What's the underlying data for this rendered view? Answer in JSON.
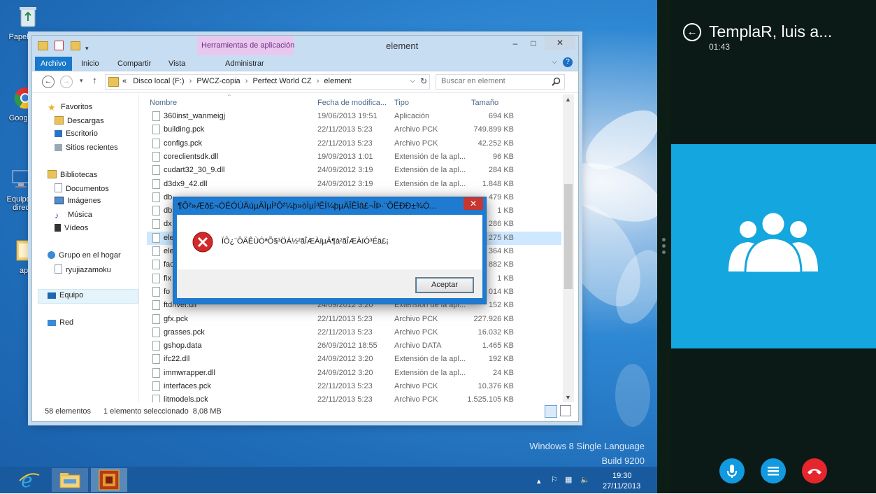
{
  "desktop": {
    "icons": [
      {
        "label": "Papelera de reciclaje",
        "short": "Papele reci"
      },
      {
        "label": "Google Chrome",
        "short": "Google C"
      },
      {
        "label": "Equipo - direct",
        "short": "Equipo - direc"
      },
      {
        "label": "ap",
        "short": "ap"
      }
    ],
    "watermark_line1": "Windows 8 Single Language",
    "watermark_line2": "Build 9200"
  },
  "explorer": {
    "title": "element",
    "contextual_group": "Herramientas de aplicación",
    "tabs": [
      "Archivo",
      "Inicio",
      "Compartir",
      "Vista",
      "Administrar"
    ],
    "breadcrumb": [
      "«",
      "Disco local (F:)",
      "PWCZ-copia",
      "Perfect World CZ",
      "element"
    ],
    "search_placeholder": "Buscar en element",
    "nav": {
      "favorites": "Favoritos",
      "downloads": "Descargas",
      "desktop": "Escritorio",
      "recent": "Sitios recientes",
      "libraries": "Bibliotecas",
      "documents": "Documentos",
      "images": "Imágenes",
      "music": "Música",
      "videos": "Vídeos",
      "homegroup": "Grupo en el hogar",
      "user": "ryujiazamoku",
      "computer": "Equipo",
      "network": "Red"
    },
    "columns": {
      "name": "Nombre",
      "date": "Fecha de modifica...",
      "type": "Tipo",
      "size": "Tamaño"
    },
    "rows": [
      {
        "name": "360inst_wanmeigj",
        "date": "19/06/2013 19:51",
        "type": "Aplicación",
        "size": "694 KB"
      },
      {
        "name": "building.pck",
        "date": "22/11/2013 5:23",
        "type": "Archivo PCK",
        "size": "749.899 KB"
      },
      {
        "name": "configs.pck",
        "date": "22/11/2013 5:23",
        "type": "Archivo PCK",
        "size": "42.252 KB"
      },
      {
        "name": "coreclientsdk.dll",
        "date": "19/09/2013 1:01",
        "type": "Extensión de la apl...",
        "size": "96 KB"
      },
      {
        "name": "cudart32_30_9.dll",
        "date": "24/09/2012 3:19",
        "type": "Extensión de la apl...",
        "size": "284 KB"
      },
      {
        "name": "d3dx9_42.dll",
        "date": "24/09/2012 3:19",
        "type": "Extensión de la apl...",
        "size": "1.848 KB"
      },
      {
        "name": "db",
        "date": "",
        "type": "",
        "size": "479 KB"
      },
      {
        "name": "db",
        "date": "",
        "type": "",
        "size": "1 KB"
      },
      {
        "name": "dx",
        "date": "",
        "type": "",
        "size": "286 KB"
      },
      {
        "name": "ele",
        "date": "",
        "type": "",
        "size": "275 KB"
      },
      {
        "name": "ele",
        "date": "",
        "type": "",
        "size": "364 KB"
      },
      {
        "name": "fac",
        "date": "",
        "type": "",
        "size": "882 KB"
      },
      {
        "name": "fix",
        "date": "",
        "type": "",
        "size": "1 KB"
      },
      {
        "name": "fo",
        "date": "",
        "type": "",
        "size": "014 KB"
      },
      {
        "name": "ftdriver.dll",
        "date": "24/09/2012 3:20",
        "type": "Extensión de la apl...",
        "size": "152 KB"
      },
      {
        "name": "gfx.pck",
        "date": "22/11/2013 5:23",
        "type": "Archivo PCK",
        "size": "227.926 KB"
      },
      {
        "name": "grasses.pck",
        "date": "22/11/2013 5:23",
        "type": "Archivo PCK",
        "size": "16.032 KB"
      },
      {
        "name": "gshop.data",
        "date": "26/09/2012 18:55",
        "type": "Archivo DATA",
        "size": "1.465 KB"
      },
      {
        "name": "ifc22.dll",
        "date": "24/09/2012 3:20",
        "type": "Extensión de la apl...",
        "size": "192 KB"
      },
      {
        "name": "immwrapper.dll",
        "date": "24/09/2012 3:20",
        "type": "Extensión de la apl...",
        "size": "24 KB"
      },
      {
        "name": "interfaces.pck",
        "date": "22/11/2013 5:23",
        "type": "Archivo PCK",
        "size": "10.376 KB"
      },
      {
        "name": "litmodels.pck",
        "date": "22/11/2013 5:23",
        "type": "Archivo PCK",
        "size": "1.525.105 KB"
      }
    ],
    "status_count": "58 elementos",
    "status_selection": "1 elemento seleccionado  8,08 MB"
  },
  "dialog": {
    "title": "¶Ô²»Æð£¬ÓÉÓÚÄúµÄÏµÍ³Ô²¼þ»òÌµÍ³ËÍ¼þµÄÎÊÌâ£¬ÎÞ·¨ÔËÐÐ±¾Ó...",
    "close": "✕",
    "message": "ÏÔ¿¨ÔÄÊÙÒªÕ§³ÖÁ½²ãÎÆÀíµÄ¶à²ãÎÆÀíÓ³Éä£¡",
    "ok": "Aceptar"
  },
  "taskbar": {
    "time": "19:30",
    "date": "27/11/2013"
  },
  "skype": {
    "name": "TemplaR, luis a...",
    "duration": "01:43"
  }
}
